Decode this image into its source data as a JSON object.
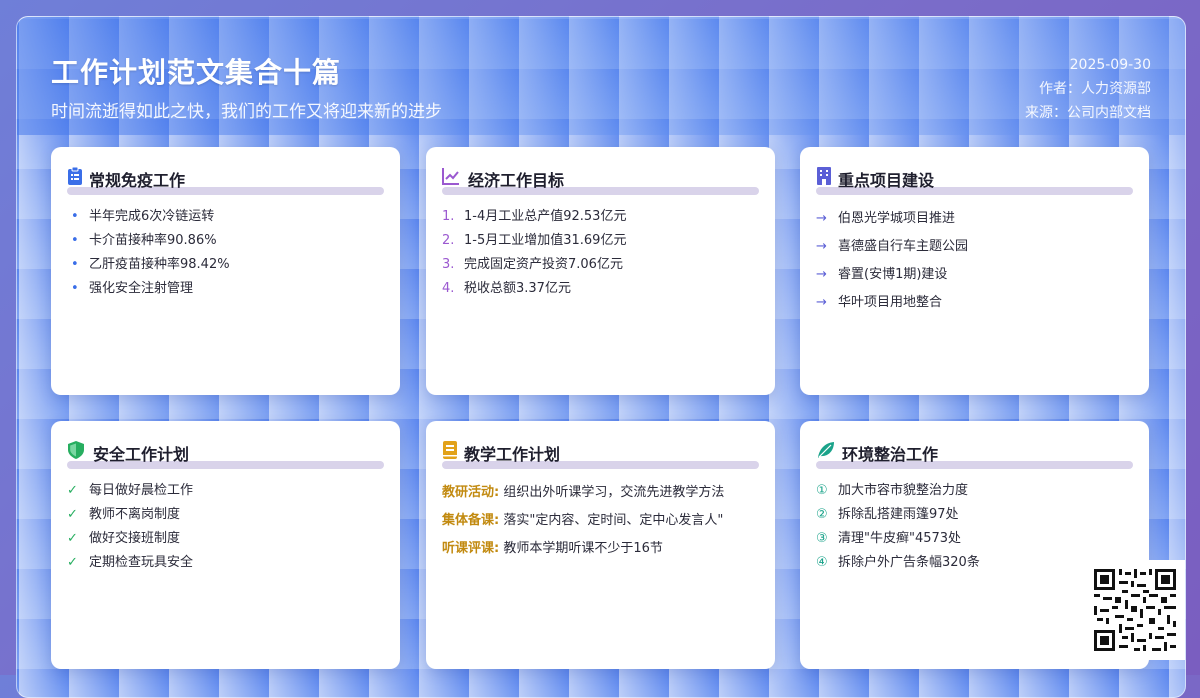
{
  "header": {
    "title": "工作计划范文集合十篇",
    "subtitle": "时间流逝得如此之快，我们的工作又将迎来新的进步",
    "date": "2025-09-30",
    "author": "作者：人力资源部",
    "source": "来源：公司内部文档"
  },
  "cards": [
    {
      "title": "常规免疫工作",
      "icon": "clipboard-icon",
      "color": "#3a6ee8",
      "marker": "•",
      "items": [
        "半年完成6次冷链运转",
        "卡介苗接种率90.86%",
        "乙肝疫苗接种率98.42%",
        "强化安全注射管理"
      ]
    },
    {
      "title": "经济工作目标",
      "icon": "chart-line-icon",
      "color": "#9b59d0",
      "items": [
        "1-4月工业总产值92.53亿元",
        "1-5月工业增加值31.69亿元",
        "完成固定资产投资7.06亿元",
        "税收总额3.37亿元"
      ],
      "markers": [
        "1.",
        "2.",
        "3.",
        "4."
      ]
    },
    {
      "title": "重点项目建设",
      "icon": "building-icon",
      "color": "#5b5fd6",
      "marker": "→",
      "items": [
        "伯恩光学城项目推进",
        "喜德盛自行车主题公园",
        "睿置(安博1期)建设",
        "华叶项目用地整合"
      ]
    },
    {
      "title": "安全工作计划",
      "icon": "shield-icon",
      "color": "#27ae60",
      "marker": "✓",
      "items": [
        "每日做好晨检工作",
        "教师不离岗制度",
        "做好交接班制度",
        "定期检查玩具安全"
      ]
    },
    {
      "title": "教学工作计划",
      "icon": "book-icon",
      "color": "#e2a21a",
      "rows": [
        {
          "label": "教研活动:",
          "text": "组织出外听课学习，交流先进教学方法"
        },
        {
          "label": "集体备课:",
          "text": "落实\"定内容、定时间、定中心发言人\""
        },
        {
          "label": "听课评课:",
          "text": "教师本学期听课不少于16节"
        }
      ]
    },
    {
      "title": "环境整治工作",
      "icon": "leaf-icon",
      "color": "#1aa38a",
      "items": [
        "加大市容市貌整治力度",
        "拆除乱搭建雨篷97处",
        "清理\"牛皮癣\"4573处",
        "拆除户外广告条幅320条"
      ],
      "markers": [
        "①",
        "②",
        "③",
        "④"
      ]
    }
  ]
}
